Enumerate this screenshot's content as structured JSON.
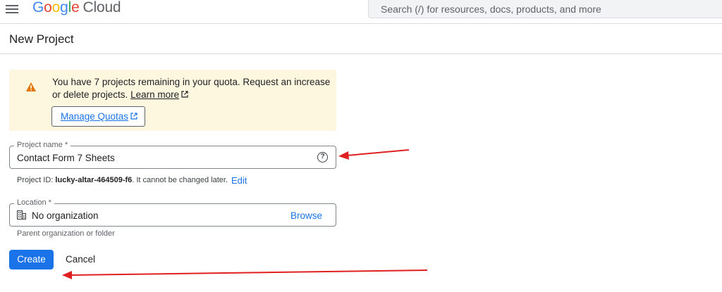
{
  "header": {
    "logo_google": [
      "G",
      "o",
      "o",
      "g",
      "l",
      "e"
    ],
    "logo_cloud": "Cloud",
    "search_placeholder": "Search (/) for resources, docs, products, and more"
  },
  "page": {
    "title": "New Project"
  },
  "quota": {
    "message": "You have 7 projects remaining in your quota. Request an increase or delete projects.",
    "learn_more": "Learn more",
    "manage_button": "Manage Quotas"
  },
  "project_name": {
    "label": "Project name *",
    "value": "Contact Form 7 Sheets",
    "help_icon": "?"
  },
  "project_id": {
    "prefix": "Project ID:",
    "id": "lucky-altar-464509-f6",
    "suffix": ". It cannot be changed later.",
    "edit": "Edit"
  },
  "location": {
    "label": "Location *",
    "value": "No organization",
    "browse": "Browse",
    "helper": "Parent organization or folder"
  },
  "actions": {
    "create": "Create",
    "cancel": "Cancel"
  },
  "colors": {
    "accent": "#1a73e8",
    "warning_bg": "#fef7e0",
    "annotation_arrow": "#e02020"
  }
}
